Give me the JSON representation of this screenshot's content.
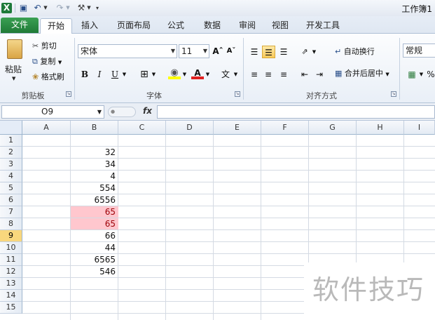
{
  "window": {
    "title": "工作簿1"
  },
  "tabs": [
    "文件",
    "开始",
    "插入",
    "页面布局",
    "公式",
    "数据",
    "审阅",
    "视图",
    "开发工具"
  ],
  "ribbon": {
    "clipboard": {
      "paste": "粘贴",
      "cut": "剪切",
      "copy": "复制",
      "format_painter": "格式刷",
      "group_label": "剪贴板"
    },
    "font": {
      "name": "宋体",
      "size": "11",
      "bold": "B",
      "italic": "I",
      "underline": "U",
      "group_label": "字体"
    },
    "alignment": {
      "wrap_text": "自动换行",
      "merge_center": "合并后居中",
      "group_label": "对齐方式"
    },
    "number": {
      "format": "常规"
    }
  },
  "formula_bar": {
    "name_box": "O9",
    "fx": "fx",
    "formula": ""
  },
  "sheet": {
    "columns": [
      "A",
      "B",
      "C",
      "D",
      "E",
      "F",
      "G",
      "H",
      "I"
    ],
    "rows": [
      "1",
      "2",
      "3",
      "4",
      "5",
      "6",
      "7",
      "8",
      "9",
      "10",
      "11",
      "12",
      "13",
      "14",
      "15"
    ],
    "selected_row": "9",
    "column_b": [
      "",
      "32",
      "34",
      "4",
      "554",
      "6556",
      "65",
      "65",
      "66",
      "44",
      "6565",
      "546"
    ],
    "highlight_color": "#ffc7ce"
  },
  "watermark": "软件技巧"
}
